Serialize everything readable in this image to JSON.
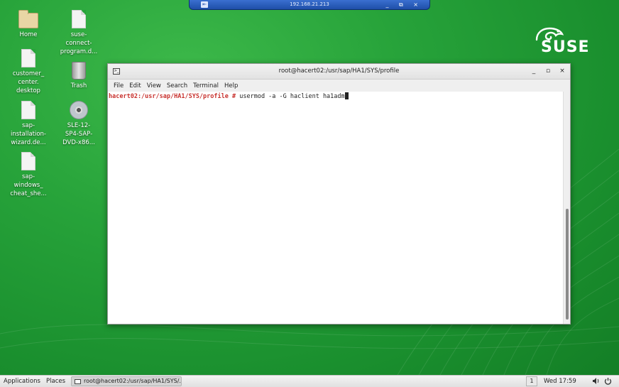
{
  "rdp_bar": {
    "host": "192.168.21.213",
    "controls": "_ ⧉ ×"
  },
  "desktop_icons": [
    {
      "label": "Home",
      "icon": "folder-icon"
    },
    {
      "label": "suse-connect-program.d...",
      "icon": "document-icon"
    },
    {
      "label": "customer_center.desktop",
      "icon": "document-icon"
    },
    {
      "label": "Trash",
      "icon": "trash-icon"
    },
    {
      "label": "sap-installation-wizard.de...",
      "icon": "document-icon"
    },
    {
      "label": "SLE-12-SP4-SAP-DVD-x86...",
      "icon": "disc-icon"
    },
    {
      "label": "sap-windows_cheat_she...",
      "icon": "document-icon"
    }
  ],
  "desktop_icon_lines": {
    "suse_connect": [
      "suse-",
      "connect-",
      "program.d..."
    ],
    "customer": [
      "customer_",
      "center.",
      "desktop"
    ],
    "sap_install": [
      "sap-",
      "installation-",
      "wizard.de..."
    ],
    "sle_dvd": [
      "SLE-12-",
      "SP4-SAP-",
      "DVD-x86..."
    ],
    "sap_windows": [
      "sap-",
      "windows_",
      "cheat_she..."
    ]
  },
  "logo": {
    "text": "SUSE"
  },
  "terminal": {
    "title": "root@hacert02:/usr/sap/HA1/SYS/profile",
    "menu": [
      "File",
      "Edit",
      "View",
      "Search",
      "Terminal",
      "Help"
    ],
    "prompt": "hacert02:/usr/sap/HA1/SYS/profile #",
    "command": " usermod -a -G haclient ha1adm",
    "buttons": {
      "minimize": "_",
      "maximize": "▫",
      "close": "×"
    }
  },
  "taskbar": {
    "applications": "Applications",
    "places": "Places",
    "task": "root@hacert02:/usr/sap/HA1/SYS/...",
    "workspace": "1",
    "clock": "Wed 17:59",
    "volume_icon": "speaker-icon",
    "power_icon": "power-icon"
  },
  "colors": {
    "desktop_green": "#27a33a",
    "prompt_red": "#c8322e"
  }
}
